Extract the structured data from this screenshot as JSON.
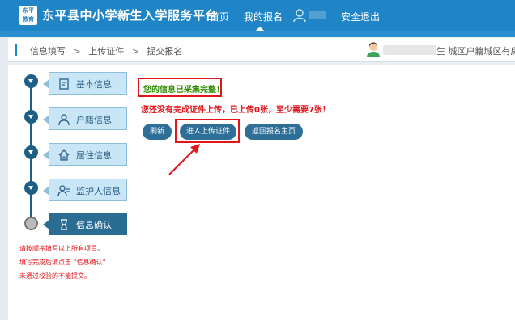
{
  "header": {
    "logo_line1": "东平",
    "logo_line2": "教育",
    "title": "东平县中小学新生入学服务平台",
    "nav": {
      "home": "首页",
      "my_signup": "我的报名",
      "logout": "安全退出"
    }
  },
  "breadcrumb": {
    "items": [
      "信息填写",
      "上传证件",
      "提交报名"
    ],
    "separator": ">",
    "user_info": "生 城区户籍城区有房信息"
  },
  "steps": [
    {
      "label": "基本信息",
      "icon": "document-icon"
    },
    {
      "label": "户籍信息",
      "icon": "person-icon"
    },
    {
      "label": "居住信息",
      "icon": "home-icon"
    },
    {
      "label": "监护人信息",
      "icon": "guardian-icon"
    },
    {
      "label": "信息确认",
      "icon": "hourglass-icon"
    }
  ],
  "notes": [
    "请按顺序填写以上所有项目。",
    "填写完成后请点击 “信息确认”",
    "未通过校验的不能提交。"
  ],
  "main": {
    "success_message": "您的信息已采集完整！",
    "warning_message": "您还没有完成证件上传，已上传0张，至少需要7张！",
    "buttons": {
      "refresh": "刷新",
      "upload": "进入上传证件",
      "back_home": "返回报名主页"
    }
  },
  "colors": {
    "header_bg": "#1f85c7",
    "button_bg": "#2e6f97",
    "highlight": "#e0161c",
    "success": "#2e8b00",
    "step_tab": "#c8e6f5",
    "step_active": "#2b6c92"
  }
}
